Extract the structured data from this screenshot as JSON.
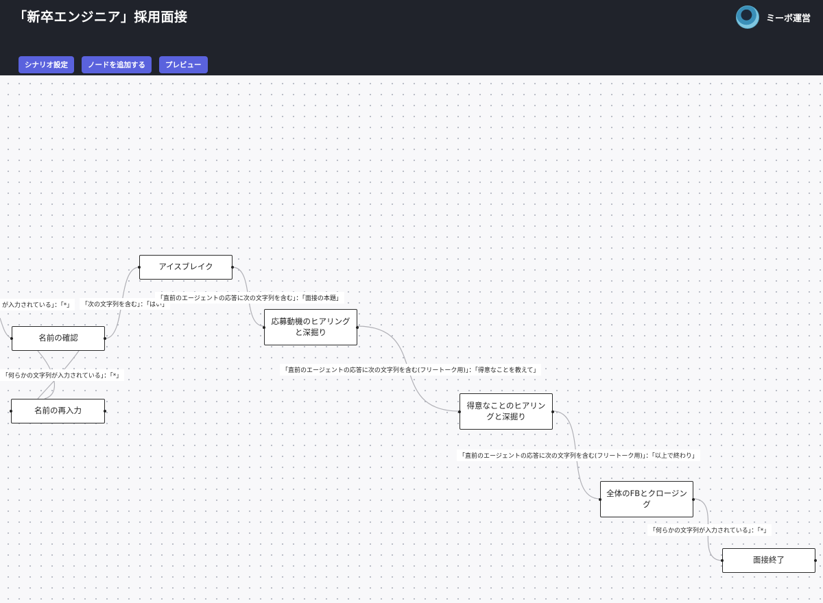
{
  "header": {
    "title": "「新卒エンジニア」採用面接",
    "user_name": "ミーボ運営"
  },
  "toolbar": {
    "scenario_settings": "シナリオ設定",
    "add_node": "ノードを追加する",
    "preview": "プレビュー"
  },
  "nodes": {
    "name_confirm": "名前の確認",
    "name_reenter": "名前の再入力",
    "icebreak": "アイスブレイク",
    "motivation": "応募動機のヒアリングと深掘り",
    "strengths": "得意なことのヒアリングと深掘り",
    "feedback": "全体のFBとクロージング",
    "end": "面接終了"
  },
  "edges": {
    "to_name_confirm": "が入力されている」：「*」",
    "to_icebreak": "「次の文字列を含む」：「はい」",
    "to_motivation": "「直前のエージェントの応答に次の文字列を含む」：「面接の本題」",
    "to_name_reenter": "「何らかの文字列が入力されている」：「*」",
    "to_strengths": "「直前のエージェントの応答に次の文字列を含む(フリートーク用)」：「得意なことを教えて」",
    "to_feedback": "「直前のエージェントの応答に次の文字列を含む(フリートーク用)」：「以上で終わり」",
    "to_end": "「何らかの文字列が入力されている」：「*」"
  },
  "colors": {
    "header_bg": "#20232b",
    "button_bg": "#5a62dd",
    "edge": "#b0b0b6"
  }
}
